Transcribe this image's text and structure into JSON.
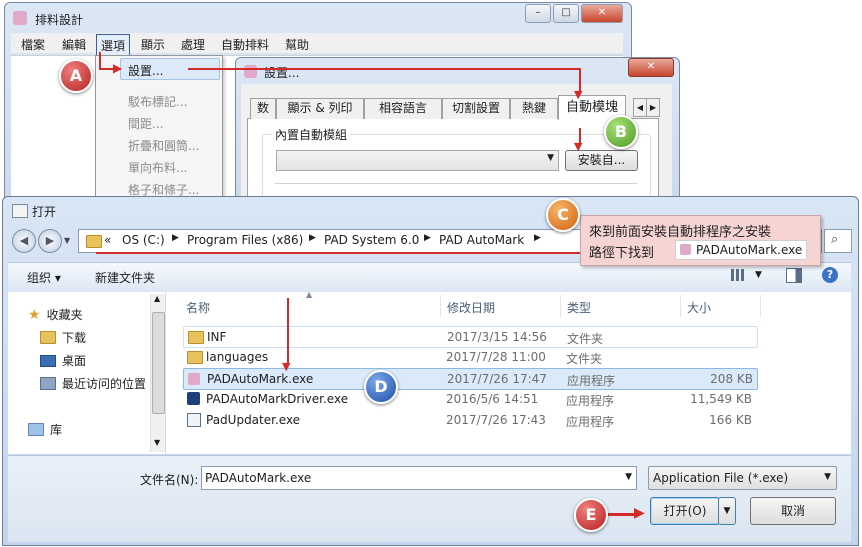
{
  "back_window": {
    "title": "排料設計",
    "menu": [
      "檔案",
      "編輯",
      "選項",
      "顯示",
      "處理",
      "自動排料",
      "幫助"
    ],
    "submenu_active": "設置...",
    "submenu_items": [
      "駁布標記...",
      "間距...",
      "折疊和圓筒...",
      "單向布料...",
      "格子和條子..."
    ]
  },
  "settings_dialog": {
    "title": "設置...",
    "tabs": [
      "数",
      "顯示 & 列印",
      "相容語言",
      "切割設置",
      "熱鍵",
      "自動模塊"
    ],
    "group_label": "內置自動模組",
    "install_button": "安裝自..."
  },
  "open_dialog": {
    "title": "打开",
    "breadcrumb": [
      "«",
      "OS (C:)",
      "Program Files (x86)",
      "PAD System 6.0",
      "PAD AutoMark"
    ],
    "organize": "组织 ▾",
    "new_folder": "新建文件夹",
    "sidebar": {
      "favorites": "收藏夹",
      "items": [
        "下载",
        "桌面",
        "最近访问的位置"
      ],
      "library": "库"
    },
    "columns": [
      "名称",
      "修改日期",
      "类型",
      "大小"
    ],
    "files": [
      {
        "name": "INF",
        "date": "2017/3/15 14:56",
        "type": "文件夹",
        "size": ""
      },
      {
        "name": "languages",
        "date": "2017/7/28 11:00",
        "type": "文件夹",
        "size": ""
      },
      {
        "name": "PADAutoMark.exe",
        "date": "2017/7/26 17:47",
        "type": "应用程序",
        "size": "208 KB"
      },
      {
        "name": "PADAutoMarkDriver.exe",
        "date": "2016/5/6 14:51",
        "type": "应用程序",
        "size": "11,549 KB"
      },
      {
        "name": "PadUpdater.exe",
        "date": "2017/7/26 17:43",
        "type": "应用程序",
        "size": "166 KB"
      }
    ],
    "filename_label": "文件名(N):",
    "filename_value": "PADAutoMark.exe",
    "filetype": "Application File (*.exe)",
    "open_button": "打开(O)",
    "cancel_button": "取消"
  },
  "callout": {
    "line1": "來到前面安裝自動排程序之安裝",
    "line2": "路徑下找到",
    "file": "PADAutoMark.exe"
  },
  "badges": [
    "A",
    "B",
    "C",
    "D",
    "E"
  ],
  "colors": {
    "accent_red": "#d42a2a",
    "callout_bg": "#f6d4d4",
    "selection": "#cce4f7"
  }
}
